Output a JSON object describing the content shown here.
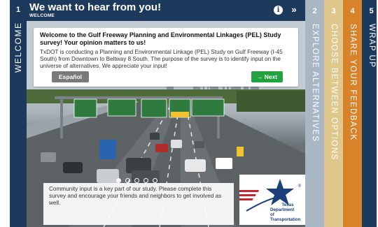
{
  "steps": {
    "welcome": {
      "number": "1",
      "label": "WELCOME"
    },
    "explore": {
      "number": "2",
      "label": "EXPLORE ALTERNATIVES"
    },
    "choose": {
      "number": "3",
      "label": "CHOOSE BETWEEN OPTIONS"
    },
    "feedback": {
      "number": "4",
      "label": "SHARE YOUR FEEDBACK"
    },
    "wrapup": {
      "number": "5",
      "label": "WRAP UP"
    }
  },
  "header": {
    "title": "We want to hear from you!",
    "subtitle": "WELCOME",
    "info_icon": "i",
    "next_icon": "»"
  },
  "card": {
    "title": "Welcome to the Gulf Freeway Planning and Environmental Linkages (PEL) Study survey! Your opinion matters to us!",
    "body": "TxDOT is conducting a Planning and Environmental Linkage (PEL) Study on Gulf Freeway (I-45 South) from Downtown to Beltway 8 South. The purpose of the survey is to identify input on the universe of alternatives. We appreciate your input!"
  },
  "buttons": {
    "espanol": "Español",
    "next": "→ Next"
  },
  "carousel": {
    "dot_count": 5,
    "active_index": 0
  },
  "bottom": {
    "text": "Community input is a key part of our study. Please complete this survey and encourage your friends and neighbors to get involved as well."
  },
  "logo": {
    "line1": "Texas",
    "line2": "Department",
    "line3": "of Transportation",
    "registered": "®"
  },
  "colors": {
    "navy": "#1d3a5c",
    "tab2": "#a9b7c4",
    "tab3": "#e0c78c",
    "tab4": "#d8822a",
    "next_green": "#22a33f"
  }
}
